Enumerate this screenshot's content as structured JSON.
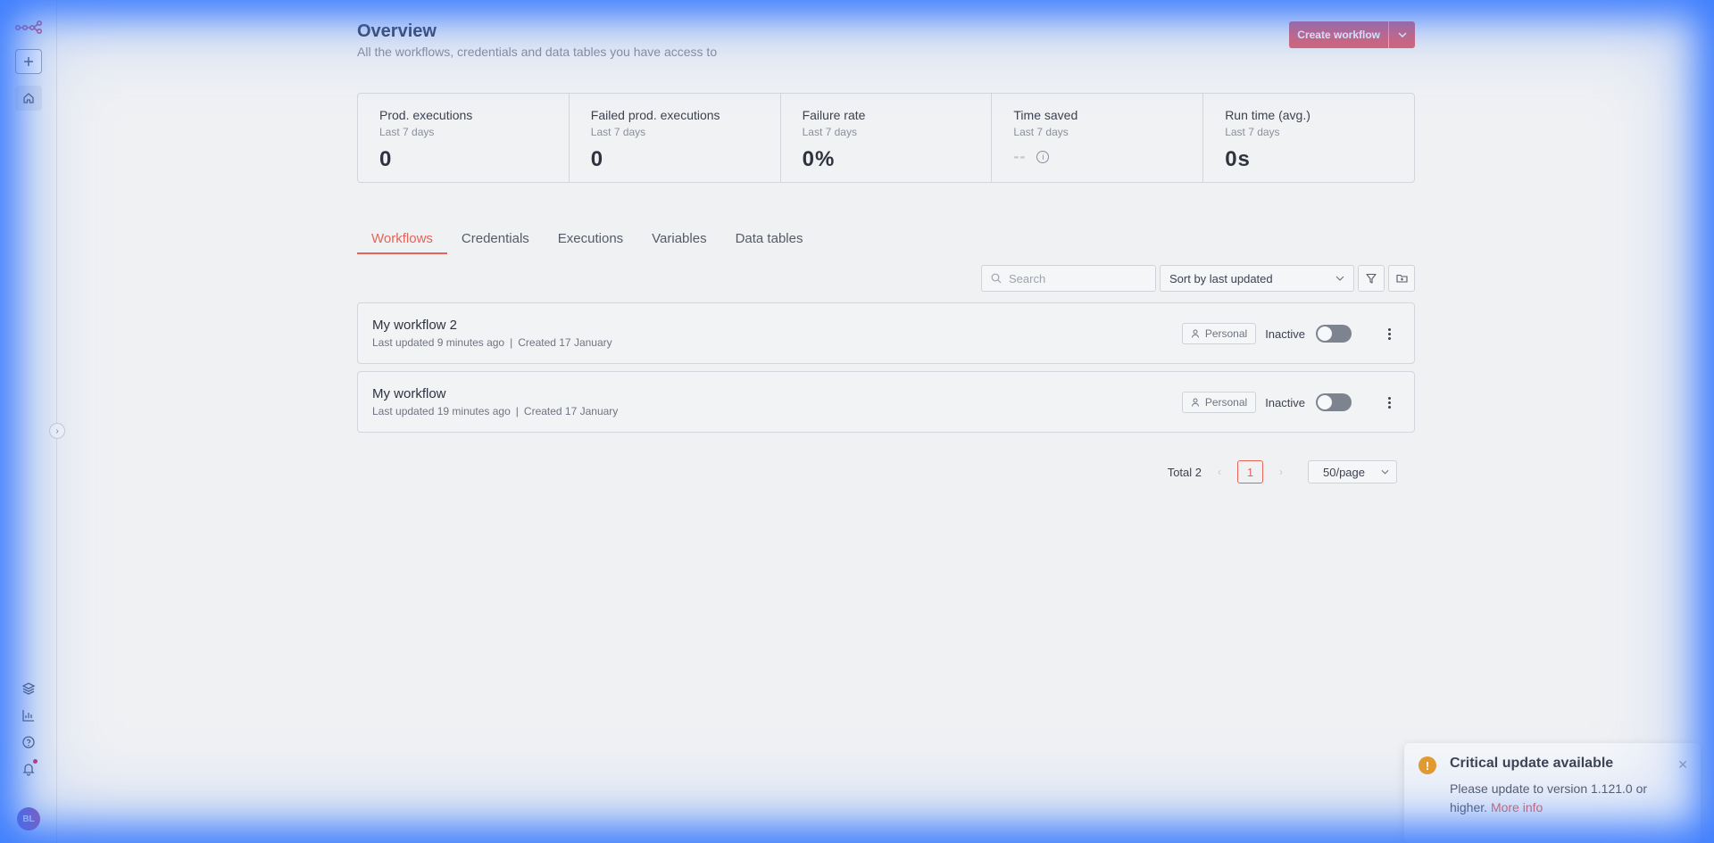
{
  "header": {
    "title": "Overview",
    "subtitle": "All the workflows, credentials and data tables you have access to",
    "create_label": "Create workflow"
  },
  "stats": [
    {
      "label": "Prod. executions",
      "range": "Last 7 days",
      "value": "0"
    },
    {
      "label": "Failed prod. executions",
      "range": "Last 7 days",
      "value": "0"
    },
    {
      "label": "Failure rate",
      "range": "Last 7 days",
      "value": "0%"
    },
    {
      "label": "Time saved",
      "range": "Last 7 days",
      "value": "--"
    },
    {
      "label": "Run time (avg.)",
      "range": "Last 7 days",
      "value": "0s"
    }
  ],
  "tabs": [
    "Workflows",
    "Credentials",
    "Executions",
    "Variables",
    "Data tables"
  ],
  "toolbar": {
    "search_placeholder": "Search",
    "sort_label": "Sort by last updated"
  },
  "workflows": [
    {
      "name": "My workflow 2",
      "updated": "Last updated 9 minutes ago",
      "created": "Created 17 January",
      "badge": "Personal",
      "status": "Inactive"
    },
    {
      "name": "My workflow",
      "updated": "Last updated 19 minutes ago",
      "created": "Created 17 January",
      "badge": "Personal",
      "status": "Inactive"
    }
  ],
  "pagination": {
    "total": "Total 2",
    "current": "1",
    "page_size": "50/page"
  },
  "toast": {
    "title": "Critical update available",
    "body": "Please update to version 1.121.0 or higher.",
    "link": "More info"
  },
  "user": {
    "initials": "BL"
  },
  "colors": {
    "accent": "#e5645a",
    "button": "#e1626c",
    "warning": "#e69b2a"
  }
}
